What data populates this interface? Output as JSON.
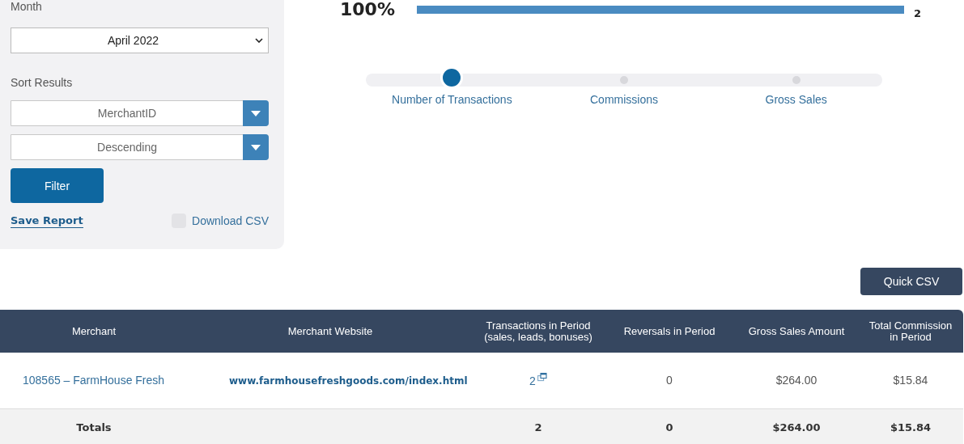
{
  "filters": {
    "month_label": "Month",
    "month": "April 2022",
    "sort_label": "Sort Results",
    "sort_by": "MerchantID",
    "order": "Descending",
    "filter_button": "Filter",
    "save_link": "Save Report",
    "download_csv": {
      "label": "Download CSV",
      "checked": false
    }
  },
  "summary_bar": {
    "percent": "100%",
    "level": 1,
    "count": "2"
  },
  "metric_slider": [
    {
      "label": "Number of Transactions",
      "selected": true
    },
    {
      "label": "Commissions",
      "selected": false
    },
    {
      "label": "Gross Sales",
      "selected": false
    }
  ],
  "quick_csv_button": "Quick CSV",
  "table": {
    "columns": [
      {
        "label": "Merchant"
      },
      {
        "label": "Merchant Website"
      },
      {
        "label": "Transactions in Period",
        "sublabel": "(sales, leads, bonuses)"
      },
      {
        "label": "Reversals in Period"
      },
      {
        "label": "Gross Sales Amount"
      },
      {
        "label": "Total Commission",
        "sublabel": "in Period"
      }
    ],
    "rows": [
      [
        "108565 – FarmHouse Fresh",
        "www.farmhousefreshgoods.com/index.html",
        "2",
        "0",
        "$264.00",
        "$15.84"
      ]
    ],
    "totals": {
      "label": "Totals",
      "cells": [
        "2",
        "0",
        "$264.00",
        "$15.84"
      ]
    }
  }
}
